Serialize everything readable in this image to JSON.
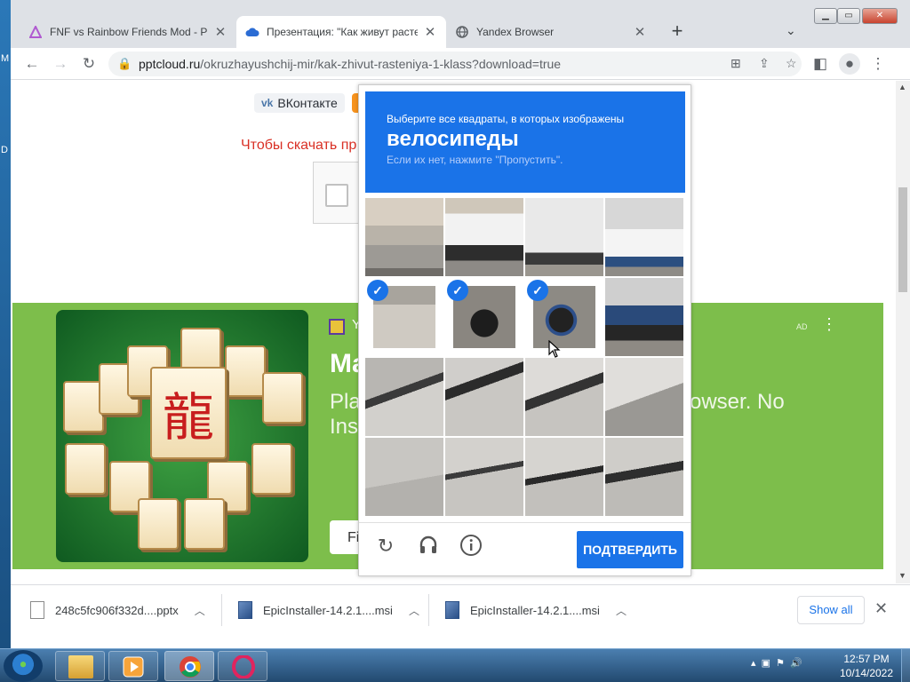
{
  "desktop": {
    "left_letters": [
      "M",
      "D"
    ]
  },
  "tabs": [
    {
      "title": "FNF vs Rainbow Friends Mod - Pl",
      "favicon": "triangle-icon",
      "active": false
    },
    {
      "title": "Презентация: \"Как живут расте",
      "favicon": "cloud-icon",
      "active": true
    },
    {
      "title": "Yandex Browser",
      "favicon": "globe-icon",
      "active": false
    }
  ],
  "toolbar": {
    "url_host": "pptcloud.ru",
    "url_path": "/okruzhayushchij-mir/kak-zhivut-rasteniya-1-klass?download=true"
  },
  "page": {
    "vk_label": "ВКонтакте",
    "download_prompt": "Чтобы скачать пр"
  },
  "ad": {
    "ad_label": "AD",
    "advertiser_initial": "Y",
    "title": "Ma",
    "desc_left": "Pla\nIns",
    "desc_right": "owser. No",
    "button_label": "Fi"
  },
  "captcha": {
    "instruction": "Выберите все квадраты, в которых изображены",
    "target": "велосипеды",
    "hint": "Если их нет, нажмите \"Пропустить\".",
    "verify_label": "ПОДТВЕРДИТЬ",
    "selected_cells": [
      4,
      5,
      6
    ]
  },
  "downloads": [
    {
      "name": "248c5fc906f332d....pptx",
      "type": "file"
    },
    {
      "name": "EpicInstaller-14.2.1....msi",
      "type": "msi"
    },
    {
      "name": "EpicInstaller-14.2.1....msi",
      "type": "msi"
    }
  ],
  "download_shelf": {
    "show_all_label": "Show all"
  },
  "taskbar": {
    "time": "12:57 PM",
    "date": "10/14/2022"
  },
  "colors": {
    "accent": "#1a73e8",
    "ad_bg": "#7dbe4b",
    "prompt_red": "#d93025"
  }
}
